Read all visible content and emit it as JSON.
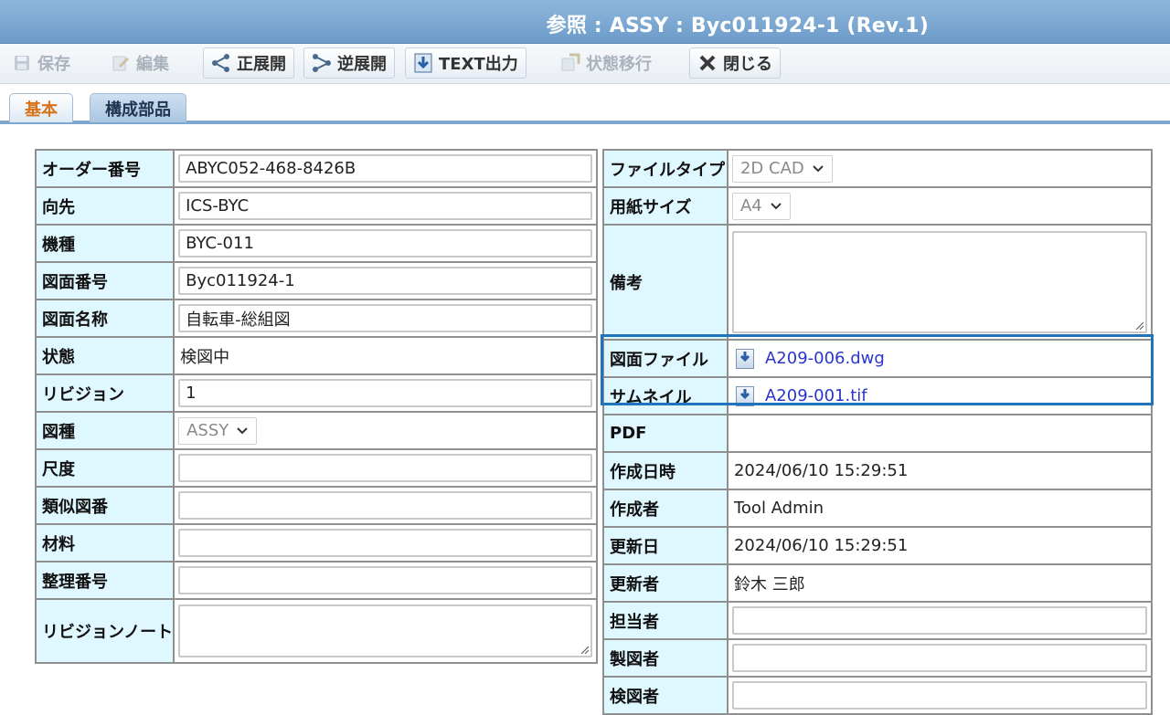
{
  "window": {
    "title": "参照 : ASSY : Byc011924-1 (Rev.1)"
  },
  "toolbar": {
    "save": "保存",
    "edit": "編集",
    "forward": "正展開",
    "reverse": "逆展開",
    "text_output": "TEXT出力",
    "state_change": "状態移行",
    "close": "閉じる"
  },
  "tabs": {
    "basic": "基本",
    "components": "構成部品"
  },
  "left": {
    "order_no": {
      "label": "オーダー番号",
      "value": "ABYC052-468-8426B"
    },
    "destination": {
      "label": "向先",
      "value": "ICS-BYC"
    },
    "model": {
      "label": "機種",
      "value": "BYC-011"
    },
    "drawing_no": {
      "label": "図面番号",
      "value": "Byc011924-1"
    },
    "drawing_name": {
      "label": "図面名称",
      "value": "自転車-総組図"
    },
    "status": {
      "label": "状態",
      "value": "検図中"
    },
    "revision": {
      "label": "リビジョン",
      "value": "1"
    },
    "drawing_type": {
      "label": "図種",
      "value": "ASSY"
    },
    "scale": {
      "label": "尺度",
      "value": ""
    },
    "similar_no": {
      "label": "類似図番",
      "value": ""
    },
    "material": {
      "label": "材料",
      "value": ""
    },
    "ref_no": {
      "label": "整理番号",
      "value": ""
    },
    "revision_note": {
      "label": "リビジョンノート",
      "value": ""
    }
  },
  "right": {
    "file_type": {
      "label": "ファイルタイプ",
      "value": "2D CAD"
    },
    "paper_size": {
      "label": "用紙サイズ",
      "value": "A4"
    },
    "remarks": {
      "label": "備考",
      "value": ""
    },
    "drawing_file": {
      "label": "図面ファイル",
      "value": "A209-006.dwg"
    },
    "thumbnail": {
      "label": "サムネイル",
      "value": "A209-001.tif"
    },
    "pdf": {
      "label": "PDF",
      "value": ""
    },
    "created_at": {
      "label": "作成日時",
      "value": "2024/06/10 15:29:51"
    },
    "created_by": {
      "label": "作成者",
      "value": "Tool Admin"
    },
    "updated_at": {
      "label": "更新日",
      "value": "2024/06/10 15:29:51"
    },
    "updated_by": {
      "label": "更新者",
      "value": "鈴木 三郎"
    },
    "person_in_charge": {
      "label": "担当者",
      "value": ""
    },
    "drafter": {
      "label": "製図者",
      "value": ""
    },
    "checker": {
      "label": "検図者",
      "value": ""
    }
  },
  "colors": {
    "label_bg": "#dff7ff",
    "title_bar": "#7ea7cf",
    "active_tab_text": "#d9731a",
    "link": "#2a35c9",
    "highlight": "#1f74bd"
  }
}
